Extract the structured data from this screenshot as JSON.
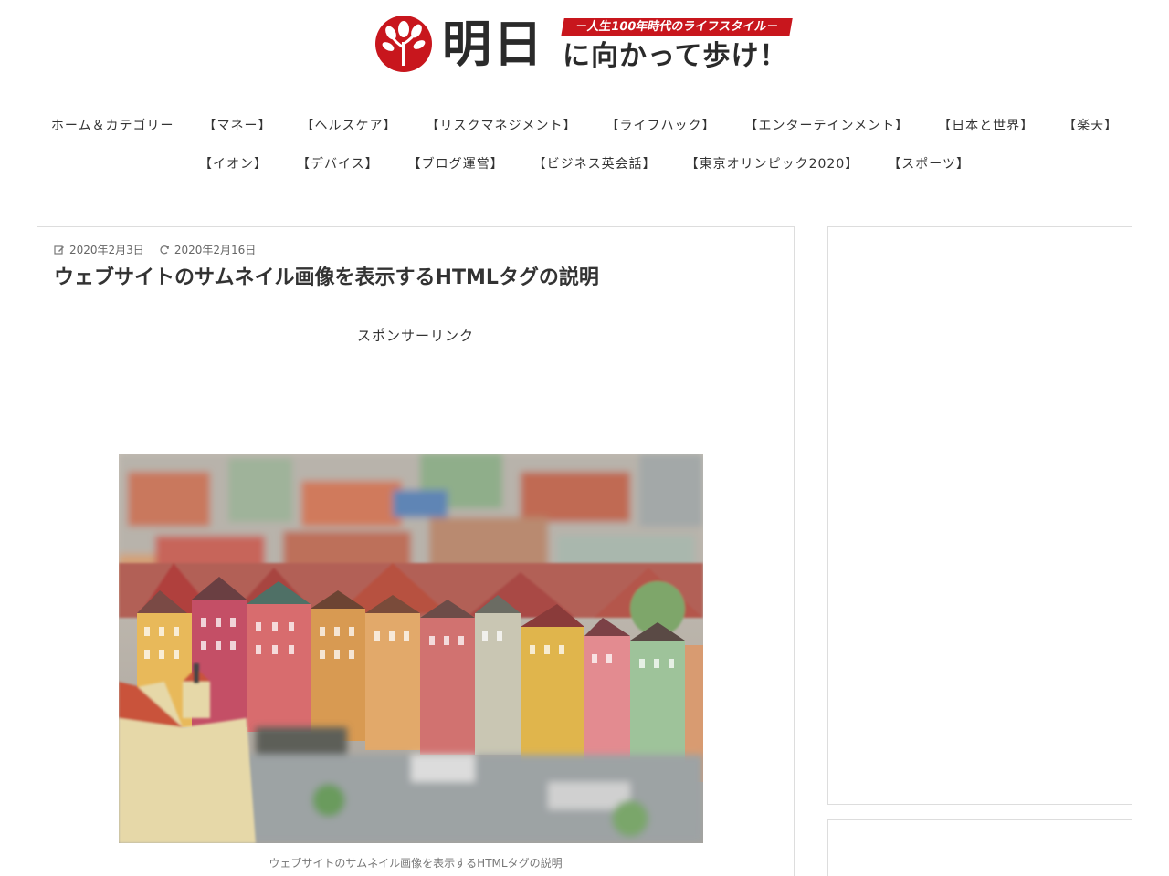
{
  "site": {
    "logo_main": "明日",
    "logo_banner": "－人生100年時代のライフスタイル－",
    "logo_sub": "に向かって歩け！"
  },
  "nav": {
    "row1": [
      "ホーム＆カテゴリー",
      "【マネー】",
      "【ヘルスケア】",
      "【リスクマネジメント】",
      "【ライフハック】",
      "【エンターテインメント】",
      "【日本と世界】",
      "【楽天】"
    ],
    "row2": [
      "【イオン】",
      "【デバイス】",
      "【ブログ運営】",
      "【ビジネス英会話】",
      "【東京オリンピック2020】",
      "【スポーツ】"
    ]
  },
  "article": {
    "published_date": "2020年2月3日",
    "updated_date": "2020年2月16日",
    "title": "ウェブサイトのサムネイル画像を表示するHTMLタグの説明",
    "sponsor_label": "スポンサーリンク",
    "image_caption": "ウェブサイトのサムネイル画像を表示するHTMLタグの説明"
  },
  "colors": {
    "brand_red": "#c8161d",
    "text": "#333333",
    "border": "#dddddd"
  }
}
